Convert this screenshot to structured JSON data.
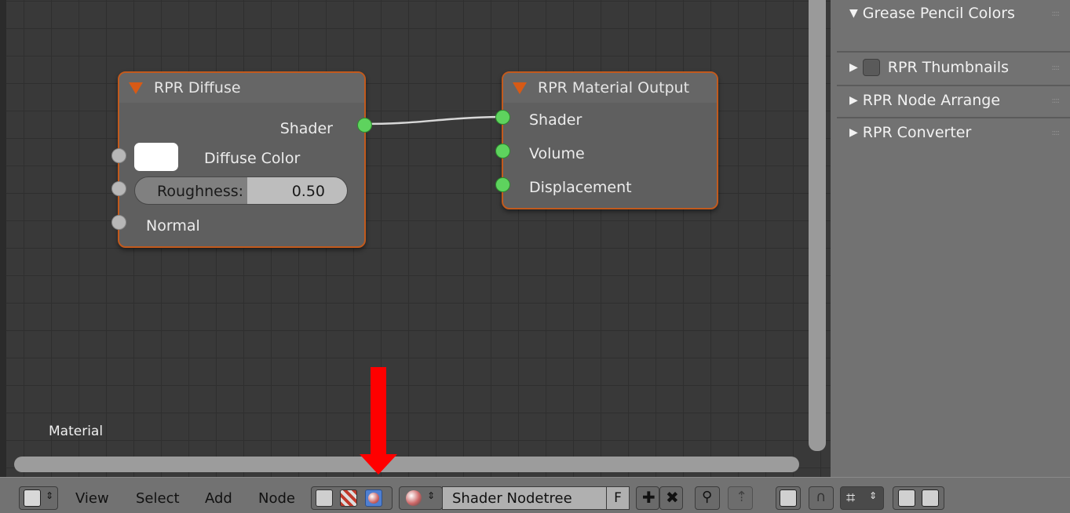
{
  "nodes": {
    "diffuse": {
      "title": "RPR Diffuse",
      "output_shader": "Shader",
      "diffuse_color_label": "Diffuse Color",
      "roughness_label": "Roughness:",
      "roughness_value": "0.50",
      "normal_label": "Normal"
    },
    "output": {
      "title": "RPR Material Output",
      "inputs": [
        "Shader",
        "Volume",
        "Displacement"
      ]
    }
  },
  "editor": {
    "material_label": "Material"
  },
  "sidebar": {
    "panels": [
      {
        "label": "Grease Pencil Colors",
        "expanded": true
      },
      {
        "label": "RPR Thumbnails",
        "expanded": false,
        "checkbox": true
      },
      {
        "label": "RPR Node Arrange",
        "expanded": false
      },
      {
        "label": "RPR Converter",
        "expanded": false
      }
    ]
  },
  "header": {
    "menus": [
      "View",
      "Select",
      "Add",
      "Node"
    ],
    "nodetree_name": "Shader Nodetree",
    "fake_user_label": "F"
  },
  "colors": {
    "node_border": "#c25a1d",
    "socket_shader": "#5ed35e",
    "socket_value": "#b7b7b7",
    "annotation_arrow": "#ff0000"
  },
  "icons": [
    "editor-type-icon",
    "object-shader-icon",
    "world-shader-icon",
    "material-shader-icon",
    "material-sphere-icon",
    "add-icon",
    "unlink-icon",
    "pin-icon",
    "go-to-parent-icon",
    "snap-icon",
    "magnet-icon",
    "snap-grid-icon",
    "copy-paste-icon"
  ]
}
